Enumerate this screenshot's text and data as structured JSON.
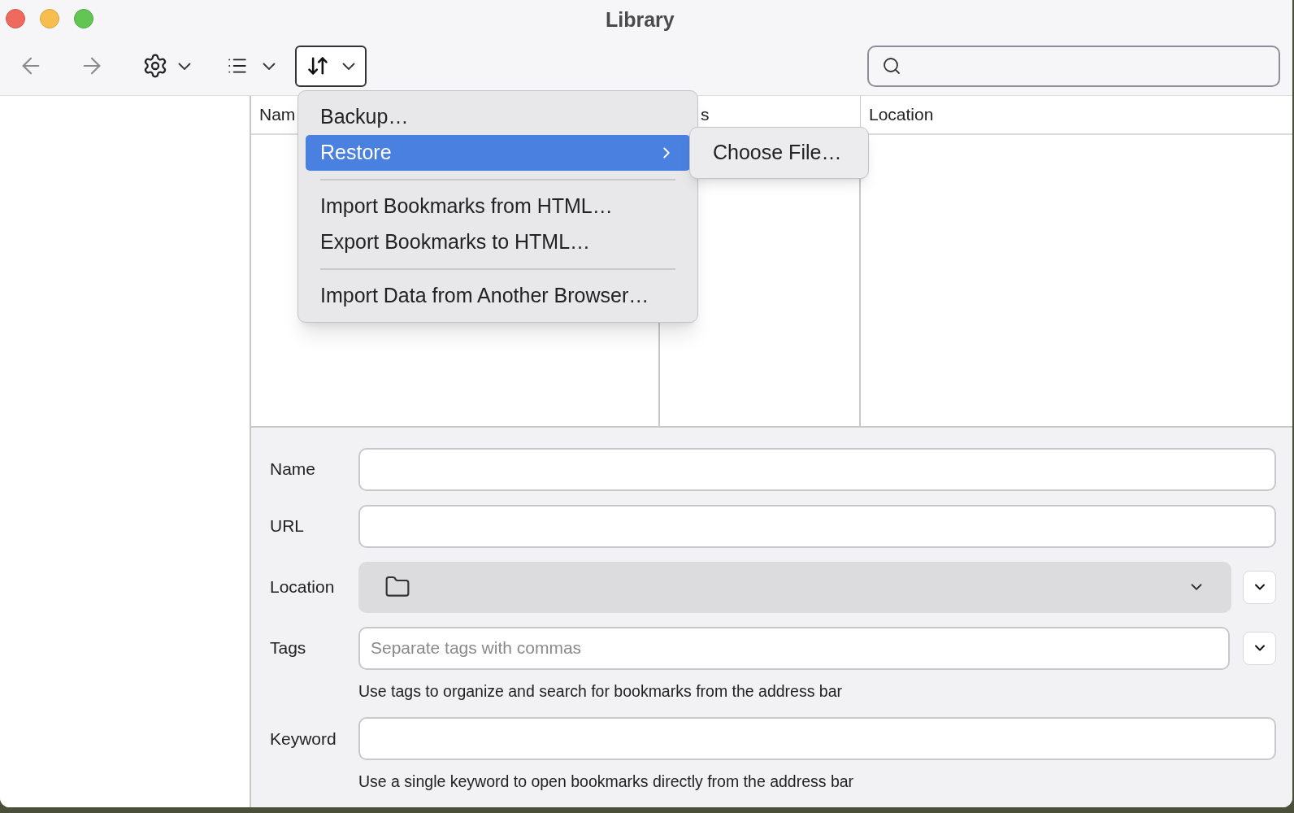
{
  "window": {
    "title": "Library"
  },
  "table": {
    "columns": [
      "Nam",
      "s",
      "Location"
    ]
  },
  "menu": {
    "items": [
      {
        "kind": "item",
        "label": "Backup…",
        "selected": false
      },
      {
        "kind": "item",
        "label": "Restore",
        "selected": true,
        "submenu": [
          "Choose File…"
        ]
      },
      {
        "kind": "separator"
      },
      {
        "kind": "item",
        "label": "Import Bookmarks from HTML…",
        "selected": false
      },
      {
        "kind": "item",
        "label": "Export Bookmarks to HTML…",
        "selected": false
      },
      {
        "kind": "separator"
      },
      {
        "kind": "item",
        "label": "Import Data from Another Browser…",
        "selected": false
      }
    ]
  },
  "details": [
    {
      "kind": "text",
      "label": "Name"
    },
    {
      "kind": "text",
      "label": "URL"
    },
    {
      "kind": "folder",
      "label": "Location"
    },
    {
      "kind": "tags",
      "label": "Tags",
      "placeholder": "Separate tags with commas",
      "hint": "Use tags to organize and search for bookmarks from the address bar"
    },
    {
      "kind": "text",
      "label": "Keyword",
      "hint": "Use a single keyword to open bookmarks directly from the address bar"
    }
  ]
}
